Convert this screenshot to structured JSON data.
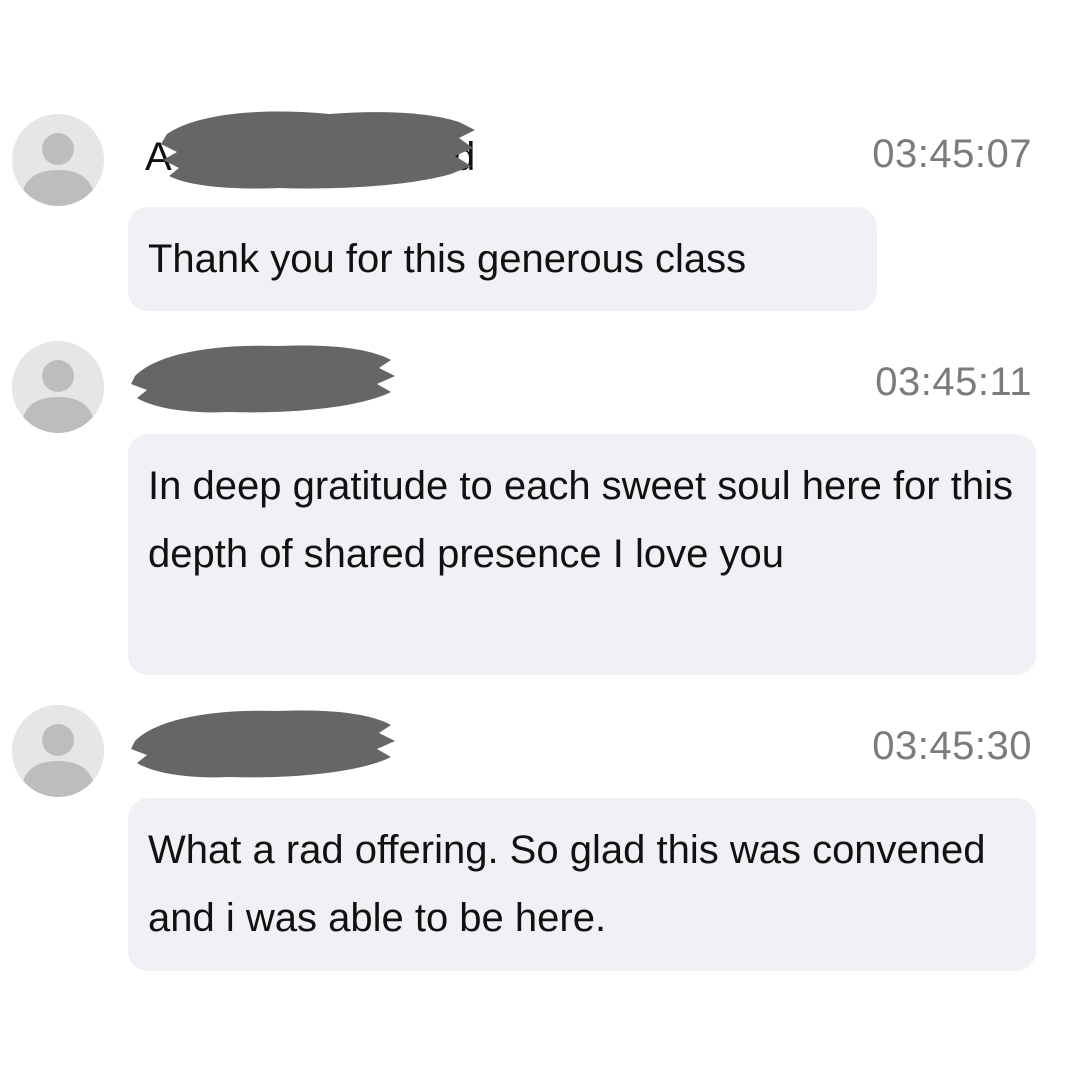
{
  "messages": [
    {
      "sender_visible_start": "A",
      "sender_visible_end": "d",
      "time": "03:45:07",
      "text": "Thank you for this generous class"
    },
    {
      "sender_visible_start": "",
      "sender_visible_end": "",
      "time": "03:45:11",
      "text": "In deep gratitude to each sweet soul here for this depth of shared presence I love you"
    },
    {
      "sender_visible_start": "",
      "sender_visible_end": "",
      "time": "03:45:30",
      "text": "What a rad offering. So glad this was convened and i was able to be here."
    }
  ],
  "colors": {
    "bubble_background": "#f1f0f5",
    "avatar_background": "#e6e6e6",
    "avatar_figure": "#bdbdbd",
    "timestamp": "#7b7b7b",
    "redaction": "#666666"
  },
  "icons": {
    "avatar": "default-user-avatar-icon"
  }
}
